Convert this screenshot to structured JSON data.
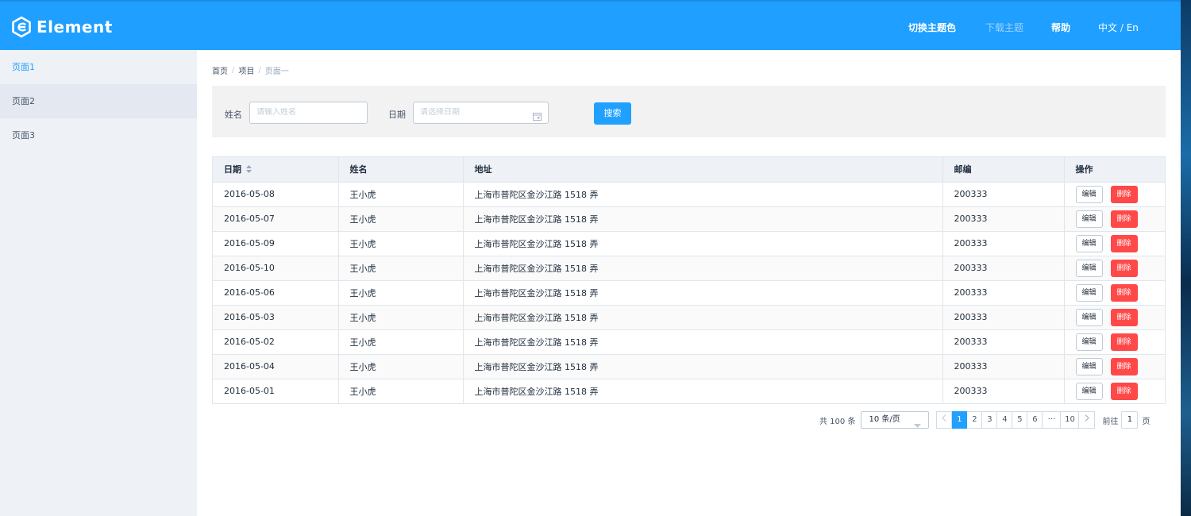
{
  "brand": {
    "logo_text": "Element",
    "header_color": "#1f9fff"
  },
  "header_nav": {
    "theme": "切换主题色",
    "download_theme": "下载主题",
    "help": "帮助",
    "lang_cn": "中文",
    "lang_sep": " / ",
    "lang_en": "En"
  },
  "sidebar": {
    "items": [
      {
        "label": "页面1",
        "active": true
      },
      {
        "label": "页面2",
        "hover": true
      },
      {
        "label": "页面3"
      }
    ]
  },
  "breadcrumb": {
    "items": [
      "首页",
      "项目",
      "页面一"
    ],
    "separator": "/"
  },
  "search": {
    "name_label": "姓名",
    "name_placeholder": "请输入姓名",
    "date_label": "日期",
    "date_placeholder": "请选择日期",
    "button": "搜索"
  },
  "table": {
    "columns": {
      "date": "日期",
      "name": "姓名",
      "address": "地址",
      "zip": "邮编",
      "actions": "操作"
    },
    "edit_label": "编辑",
    "delete_label": "删除",
    "rows": [
      {
        "date": "2016-05-08",
        "name": "王小虎",
        "address": "上海市普陀区金沙江路 1518 弄",
        "zip": "200333"
      },
      {
        "date": "2016-05-07",
        "name": "王小虎",
        "address": "上海市普陀区金沙江路 1518 弄",
        "zip": "200333"
      },
      {
        "date": "2016-05-09",
        "name": "王小虎",
        "address": "上海市普陀区金沙江路 1518 弄",
        "zip": "200333"
      },
      {
        "date": "2016-05-10",
        "name": "王小虎",
        "address": "上海市普陀区金沙江路 1518 弄",
        "zip": "200333"
      },
      {
        "date": "2016-05-06",
        "name": "王小虎",
        "address": "上海市普陀区金沙江路 1518 弄",
        "zip": "200333"
      },
      {
        "date": "2016-05-03",
        "name": "王小虎",
        "address": "上海市普陀区金沙江路 1518 弄",
        "zip": "200333"
      },
      {
        "date": "2016-05-02",
        "name": "王小虎",
        "address": "上海市普陀区金沙江路 1518 弄",
        "zip": "200333"
      },
      {
        "date": "2016-05-04",
        "name": "王小虎",
        "address": "上海市普陀区金沙江路 1518 弄",
        "zip": "200333"
      },
      {
        "date": "2016-05-01",
        "name": "王小虎",
        "address": "上海市普陀区金沙江路 1518 弄",
        "zip": "200333"
      }
    ]
  },
  "pagination": {
    "total_text": "共 100 条",
    "page_size": "10 条/页",
    "pages": [
      "1",
      "2",
      "3",
      "4",
      "5",
      "6",
      "···",
      "10"
    ],
    "current": "1",
    "goto_label": "前往",
    "goto_value": "1",
    "goto_suffix": "页"
  }
}
